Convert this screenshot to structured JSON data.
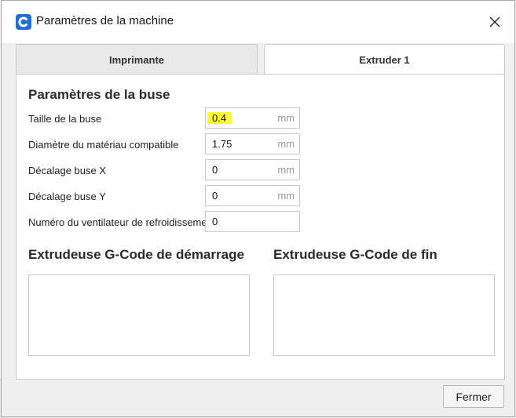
{
  "window": {
    "title": "Paramètres de la machine"
  },
  "tabs": [
    {
      "label": "Imprimante",
      "active": false
    },
    {
      "label": "Extruder 1",
      "active": true
    }
  ],
  "nozzle_section": {
    "title": "Paramètres de la buse",
    "fields": [
      {
        "label": "Taille de la buse",
        "value": "0.4",
        "unit": "mm",
        "highlighted": true
      },
      {
        "label": "Diamètre du matériau compatible",
        "value": "1.75",
        "unit": "mm"
      },
      {
        "label": "Décalage buse X",
        "value": "0",
        "unit": "mm"
      },
      {
        "label": "Décalage buse Y",
        "value": "0",
        "unit": "mm"
      },
      {
        "label": "Numéro du ventilateur de refroidissement",
        "value": "0",
        "unit": ""
      }
    ]
  },
  "gcode": {
    "start_title": "Extrudeuse G-Code de démarrage",
    "end_title": "Extrudeuse G-Code de fin",
    "start_value": "",
    "end_value": ""
  },
  "footer": {
    "close_label": "Fermer"
  },
  "colors": {
    "highlight": "#ffff33",
    "app_icon": "#1f6fd6"
  }
}
